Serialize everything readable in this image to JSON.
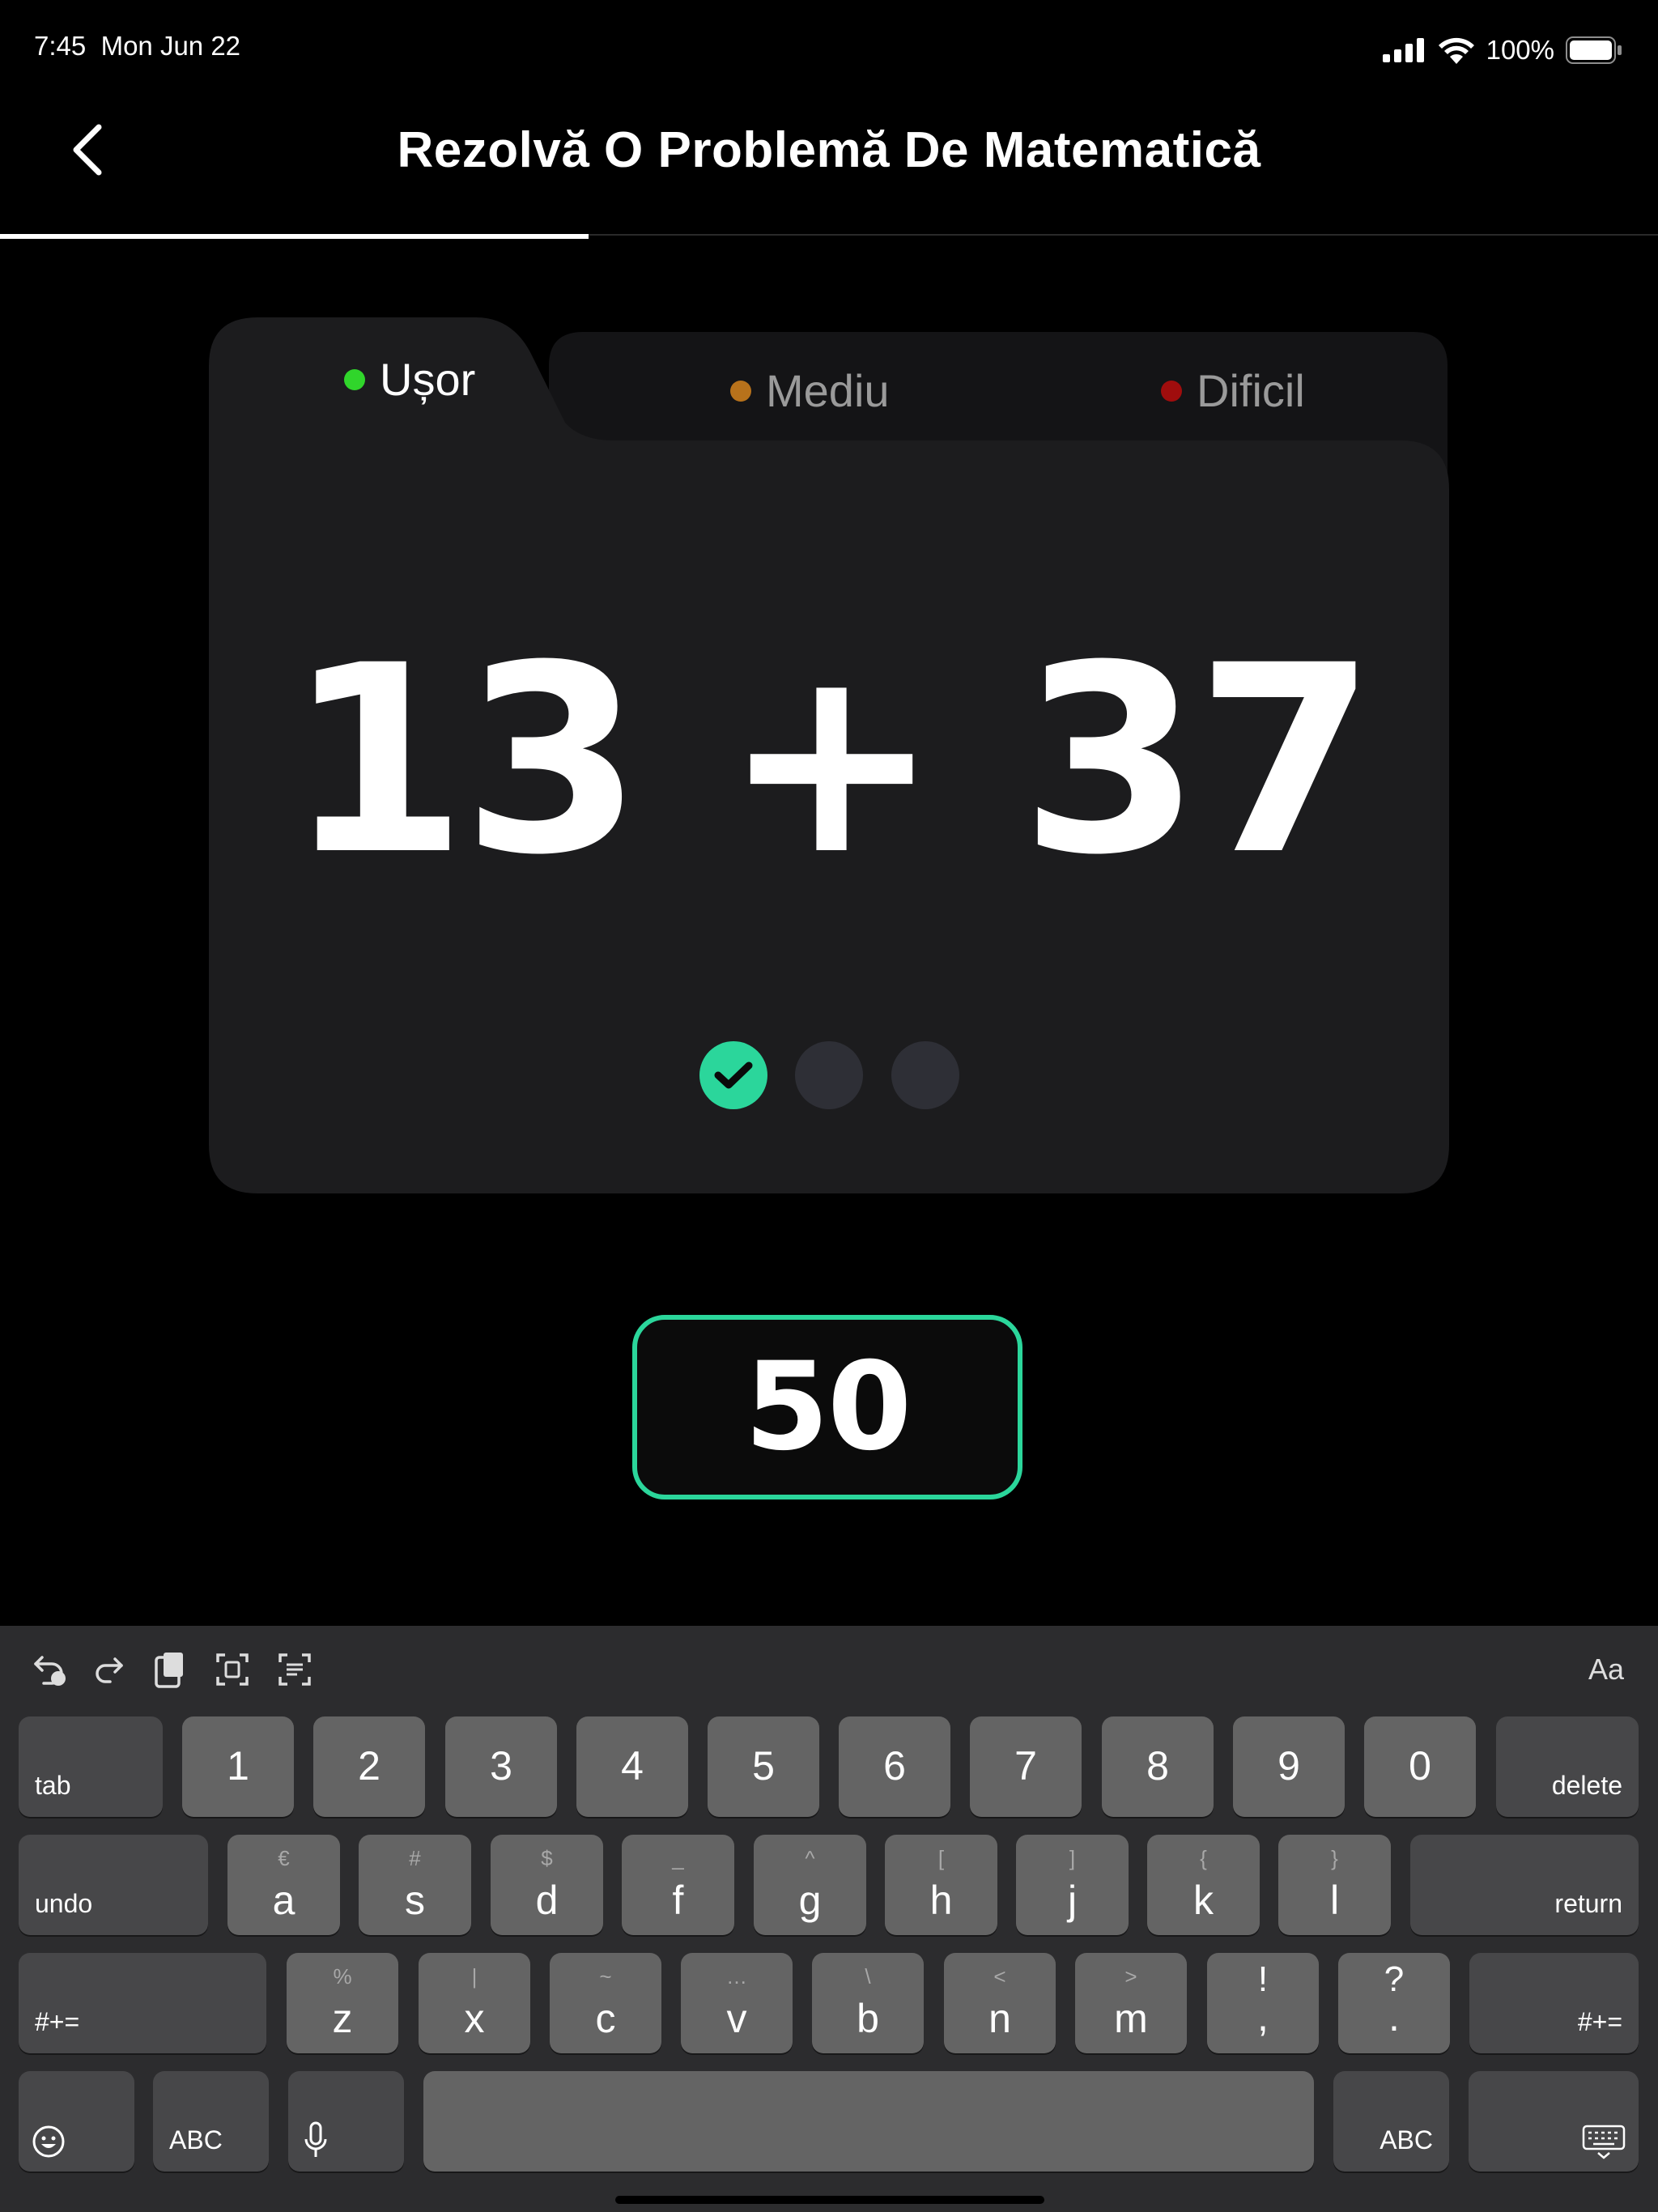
{
  "status_bar": {
    "time": "7:45",
    "date": "Mon Jun 22",
    "battery": "100%"
  },
  "header": {
    "title": "Rezolvă O Problemă De Matematică",
    "progress": 0.355
  },
  "levels": [
    {
      "label": "Ușor",
      "color": "#30d52b",
      "active": true
    },
    {
      "label": "Mediu",
      "color": "#b8721b",
      "active": false
    },
    {
      "label": "Dificil",
      "color": "#a00d0d",
      "active": false
    }
  ],
  "problem": {
    "text": "13 + 37",
    "steps_total": 3,
    "steps_done": 1
  },
  "answer": {
    "value": "50"
  },
  "colors": {
    "accent": "#2bd69b",
    "card": "#1c1c1e",
    "card_back": "#141416",
    "pending_step": "#2e2f36"
  },
  "keyboard": {
    "format_label": "Aa",
    "toolbar_icons": [
      "undo-icon",
      "redo-icon",
      "paste-icon",
      "scan-text-icon",
      "text-format-icon"
    ],
    "row1": {
      "tab": "tab",
      "keys": [
        "1",
        "2",
        "3",
        "4",
        "5",
        "6",
        "7",
        "8",
        "9",
        "0"
      ],
      "delete": "delete"
    },
    "row2": {
      "undo": "undo",
      "keys": [
        {
          "main": "a",
          "alt": "€"
        },
        {
          "main": "s",
          "alt": "#"
        },
        {
          "main": "d",
          "alt": "$"
        },
        {
          "main": "f",
          "alt": "_"
        },
        {
          "main": "g",
          "alt": "^"
        },
        {
          "main": "h",
          "alt": "["
        },
        {
          "main": "j",
          "alt": "]"
        },
        {
          "main": "k",
          "alt": "{"
        },
        {
          "main": "l",
          "alt": "}"
        }
      ],
      "return": "return"
    },
    "row3": {
      "symbols_left": "#+=",
      "keys": [
        {
          "main": "z",
          "alt": "%"
        },
        {
          "main": "x",
          "alt": "|"
        },
        {
          "main": "c",
          "alt": "~"
        },
        {
          "main": "v",
          "alt": "…"
        },
        {
          "main": "b",
          "alt": "\\"
        },
        {
          "main": "n",
          "alt": "<"
        },
        {
          "main": "m",
          "alt": ">"
        },
        {
          "main": ",",
          "alt": "!"
        },
        {
          "main": ".",
          "alt": "?"
        }
      ],
      "symbols_right": "#+="
    },
    "row4": {
      "abc_left": "ABC",
      "abc_right": "ABC"
    }
  }
}
